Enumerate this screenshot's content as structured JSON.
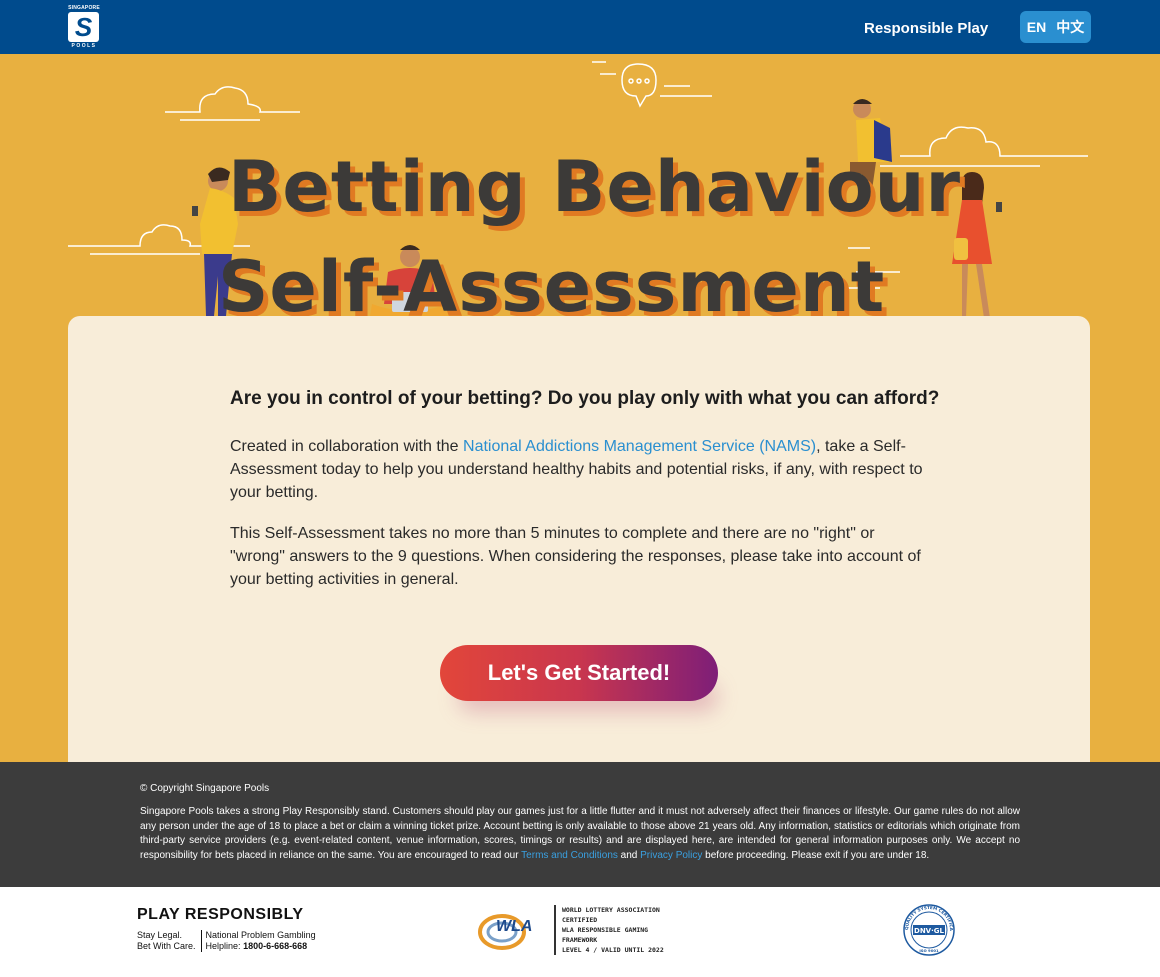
{
  "header": {
    "logo": {
      "top_text": "SINGAPORE",
      "mark": "S",
      "bottom_text": "POOLS"
    },
    "nav_link": "Responsible Play",
    "lang_en": "EN",
    "lang_zh": "中文"
  },
  "hero": {
    "title_line1": "Betting Behaviour",
    "title_line2": "Self-Assessment"
  },
  "main": {
    "heading": "Are you in control of your betting? Do you play only with what you can afford?",
    "p1_before": "Created in collaboration with the ",
    "p1_link": "National Addictions Management Service (NAMS)",
    "p1_after": ", take a Self-Assessment today to help you understand healthy habits and potential risks, if any, with respect to your betting.",
    "p2": "This Self-Assessment takes no more than 5 minutes to complete and there are no \"right\" or \"wrong\" answers to the 9 questions. When considering the responses, please take into account of your betting activities in general.",
    "cta_label": "Let's Get Started!"
  },
  "footer": {
    "copyright": "© Copyright Singapore Pools",
    "disclaimer_before": "Singapore Pools takes a strong Play Responsibly stand. Customers should play our games just for a little flutter and it must not adversely affect their finances or lifestyle. Our game rules do not allow any person under the age of 18 to place a bet or claim a winning ticket prize. Account betting is only available to those above 21 years old. Any information, statistics or editorials which originate from third-party service providers (e.g. event-related content, venue information, scores, timings or results) and are displayed here, are intended for general information purposes only. We accept no responsibility for bets placed in reliance on the same. You are encouraged to read our ",
    "terms_link": "Terms and Conditions",
    "and_text": " and ",
    "privacy_link": "Privacy Policy",
    "disclaimer_after": " before proceeding. Please exit if you are under 18."
  },
  "badges": {
    "play_responsibly": {
      "title": "PLAY RESPONSIBLY",
      "left_line1": "Stay Legal.",
      "left_line2": "Bet With Care.",
      "right_line1": "National Problem Gambling",
      "right_line2_label": "Helpline: ",
      "right_line2_number": "1800-6-668-668"
    },
    "wla": {
      "mark": "WLA",
      "line1": "WORLD LOTTERY ASSOCIATION",
      "line2": "CERTIFIED",
      "line3": "WLA RESPONSIBLE GAMING",
      "line4": "FRAMEWORK",
      "line5": "LEVEL 4 / VALID UNTIL 2022"
    },
    "dnv": {
      "ring_text": "QUALITY SYSTEM CERTIFICATION",
      "mark": "DNV·GL",
      "iso": "ISO 9001"
    }
  },
  "colors": {
    "header_bg": "#004b8d",
    "hero_bg": "#e8b040",
    "card_bg": "#f8edd9",
    "link": "#2a8fd0",
    "footer_bg": "#3c3c3c"
  }
}
